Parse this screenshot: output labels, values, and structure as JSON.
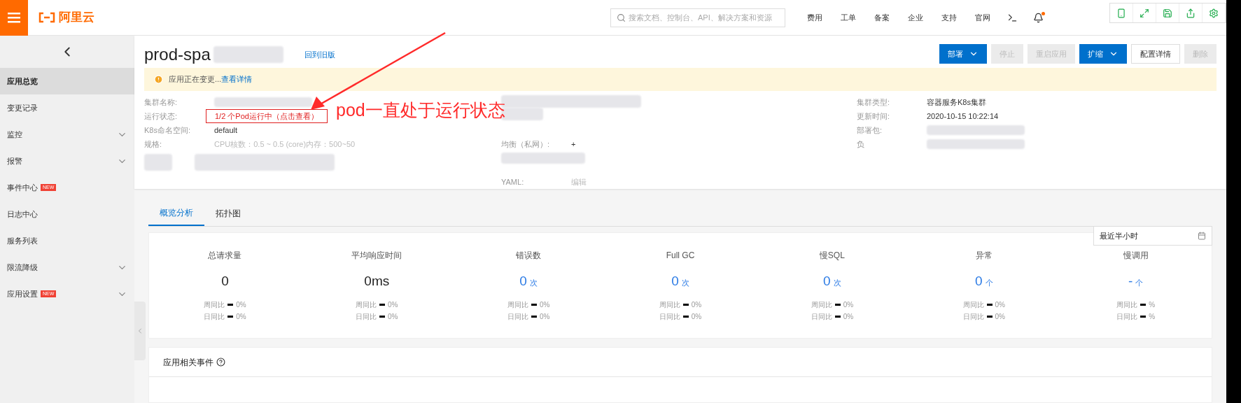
{
  "topbar": {
    "logo": "阿里云",
    "search": {
      "placeholder": "搜索文档、控制台、API、解决方案和资源"
    },
    "links": [
      "费用",
      "工单",
      "备案",
      "企业",
      "支持",
      "官网"
    ],
    "notification_dot": true
  },
  "sidebar": {
    "items": [
      {
        "label": "应用总览",
        "selected": true,
        "expandable": false
      },
      {
        "label": "变更记录",
        "selected": false,
        "expandable": false
      },
      {
        "label": "监控",
        "selected": false,
        "expandable": true
      },
      {
        "label": "报警",
        "selected": false,
        "expandable": true
      },
      {
        "label": "事件中心",
        "selected": false,
        "expandable": false,
        "badge": "NEW"
      },
      {
        "label": "日志中心",
        "selected": false,
        "expandable": false
      },
      {
        "label": "服务列表",
        "selected": false,
        "expandable": false
      },
      {
        "label": "限流降级",
        "selected": false,
        "expandable": true
      },
      {
        "label": "应用设置",
        "selected": false,
        "expandable": true,
        "badge": "NEW"
      }
    ]
  },
  "header": {
    "title": "prod-spa",
    "back_link": "回到旧版",
    "buttons": [
      {
        "label": "部署",
        "kind": "primary",
        "dropdown": true
      },
      {
        "label": "停止",
        "kind": "disabled",
        "dropdown": false
      },
      {
        "label": "重启应用",
        "kind": "disabled",
        "dropdown": false
      },
      {
        "label": "扩缩",
        "kind": "primary",
        "dropdown": true
      },
      {
        "label": "配置详情",
        "kind": "default",
        "dropdown": false
      },
      {
        "label": "删除",
        "kind": "disabled",
        "dropdown": false
      }
    ]
  },
  "banner": {
    "text": "应用正在变更...",
    "link": "查看详情"
  },
  "info": {
    "left": [
      {
        "label": "集群名称:",
        "kind": "blurred"
      },
      {
        "label": "运行状态:",
        "value": "1/2 个Pod运行中（点击查看）",
        "kind": "status"
      },
      {
        "label": "K8s命名空间:",
        "value": "default",
        "kind": "text"
      },
      {
        "label": "规格:",
        "value": "CPU核数：0.5 ~ 0.5 (core)内存：500~50",
        "kind": "faded"
      }
    ],
    "middle": [
      {
        "label": "均衡（私网）:",
        "value": "+",
        "kind": "text"
      },
      {
        "label": "YAML:",
        "value": "编辑",
        "kind": "faded"
      }
    ],
    "right": [
      {
        "label": "集群类型:",
        "value": "容器服务K8s集群",
        "kind": "text"
      },
      {
        "label": "更新时间:",
        "value": "2020-10-15 10:22:14",
        "kind": "text"
      },
      {
        "label": "部署包:",
        "kind": "blurred"
      },
      {
        "label": "负",
        "kind": "blurred"
      }
    ]
  },
  "annotation": {
    "text": "pod一直处于运行状态"
  },
  "tabs": [
    {
      "label": "概览分析",
      "selected": true
    },
    {
      "label": "拓扑图",
      "selected": false
    }
  ],
  "time_range": "最近半小时",
  "metrics": [
    {
      "title": "总请求量",
      "value": "0",
      "highlight": false,
      "compare": [
        {
          "label": "周同比",
          "value": "0%"
        },
        {
          "label": "日同比",
          "value": "0%"
        }
      ]
    },
    {
      "title": "平均响应时间",
      "value": "0ms",
      "highlight": false,
      "compare": [
        {
          "label": "周同比",
          "value": "0%"
        },
        {
          "label": "日同比",
          "value": "0%"
        }
      ]
    },
    {
      "title": "错误数",
      "value": "0",
      "unit": "次",
      "highlight": true,
      "compare": [
        {
          "label": "周同比",
          "value": "0%"
        },
        {
          "label": "日同比",
          "value": "0%"
        }
      ]
    },
    {
      "title": "Full GC",
      "value": "0",
      "unit": "次",
      "highlight": true,
      "compare": [
        {
          "label": "周同比",
          "value": "0%"
        },
        {
          "label": "日同比",
          "value": "0%"
        }
      ]
    },
    {
      "title": "慢SQL",
      "value": "0",
      "unit": "次",
      "highlight": true,
      "compare": [
        {
          "label": "周同比",
          "value": "0%"
        },
        {
          "label": "日同比",
          "value": "0%"
        }
      ]
    },
    {
      "title": "异常",
      "value": "0",
      "unit": "个",
      "highlight": true,
      "compare": [
        {
          "label": "周同比",
          "value": "0%"
        },
        {
          "label": "日同比",
          "value": "0%"
        }
      ]
    },
    {
      "title": "慢调用",
      "value": "-",
      "unit": "个",
      "highlight": true,
      "compare": [
        {
          "label": "周同比",
          "value": "%"
        },
        {
          "label": "日同比",
          "value": "%"
        }
      ]
    }
  ],
  "events": {
    "title": "应用相关事件"
  }
}
